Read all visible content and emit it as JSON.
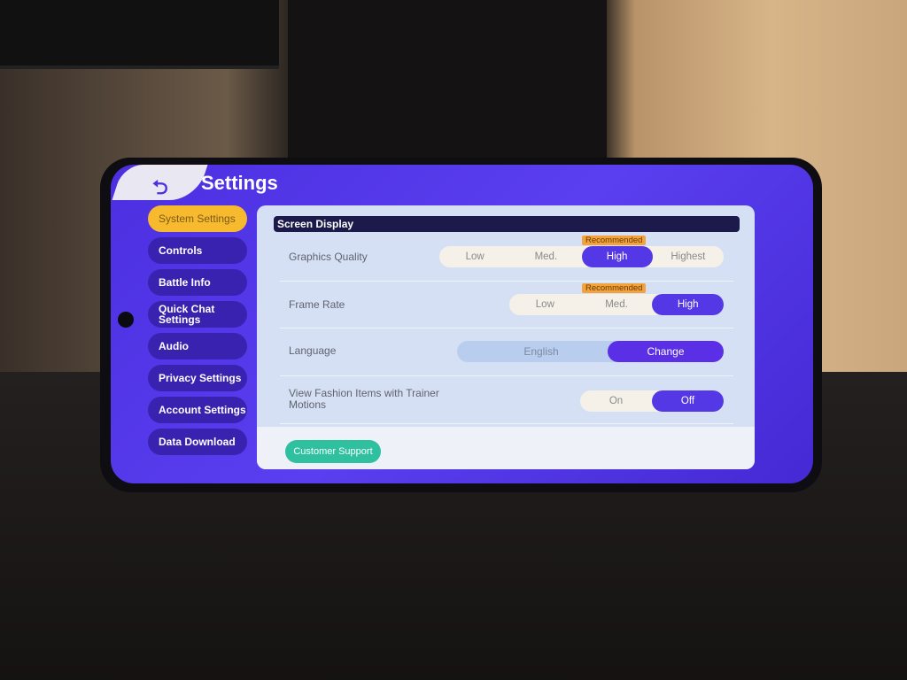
{
  "header": {
    "title": "Settings",
    "back_icon": "back-arrow-icon"
  },
  "sidebar": {
    "items": [
      {
        "label": "System Settings",
        "active": true
      },
      {
        "label": "Controls"
      },
      {
        "label": "Battle Info"
      },
      {
        "label": "Quick Chat Settings"
      },
      {
        "label": "Audio"
      },
      {
        "label": "Privacy Settings"
      },
      {
        "label": "Account Settings"
      },
      {
        "label": "Data Download"
      }
    ]
  },
  "main": {
    "section_title": "Screen Display",
    "graphics_quality": {
      "label": "Graphics Quality",
      "options": [
        "Low",
        "Med.",
        "High",
        "Highest"
      ],
      "selected": "High",
      "badge": "Recommended"
    },
    "frame_rate": {
      "label": "Frame Rate",
      "options": [
        "Low",
        "Med.",
        "High"
      ],
      "selected": "High",
      "badge": "Recommended"
    },
    "language": {
      "label": "Language",
      "value": "English",
      "button": "Change"
    },
    "fashion": {
      "label": "View Fashion Items with Trainer Motions",
      "options": [
        "On",
        "Off"
      ],
      "selected": "Off"
    },
    "customer_support": "Customer Support"
  },
  "colors": {
    "accent": "#5438e6",
    "background": "#4b2fe0",
    "active_tab": "#f7b92e",
    "recommended": "#f3a23c",
    "support": "#2fc0a0"
  }
}
